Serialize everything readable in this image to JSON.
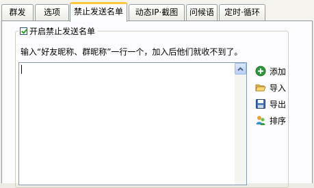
{
  "tabs": [
    {
      "label": "群发",
      "active": false
    },
    {
      "label": "选项",
      "active": false
    },
    {
      "label": "禁止发送名单",
      "active": true
    },
    {
      "label": "动态IP·截图",
      "active": false
    },
    {
      "label": "问候语",
      "active": false
    },
    {
      "label": "定时·循环",
      "active": false
    }
  ],
  "blocklist": {
    "enable_label": "开启禁止发送名单",
    "enabled": true,
    "hint": "输入“好友昵称、群昵称”一行一个，加入后他们就收不到了。",
    "textarea_value": ""
  },
  "actions": {
    "add": "添加",
    "import": "导入",
    "export": "导出",
    "sort": "排序"
  },
  "colors": {
    "active_tab_accent": "#ffc83c",
    "checkbox_check": "#21a121"
  },
  "icons": {
    "add": "plus-circle-icon",
    "import": "folder-open-icon",
    "export": "floppy-disk-icon",
    "sort": "user-group-icon"
  }
}
